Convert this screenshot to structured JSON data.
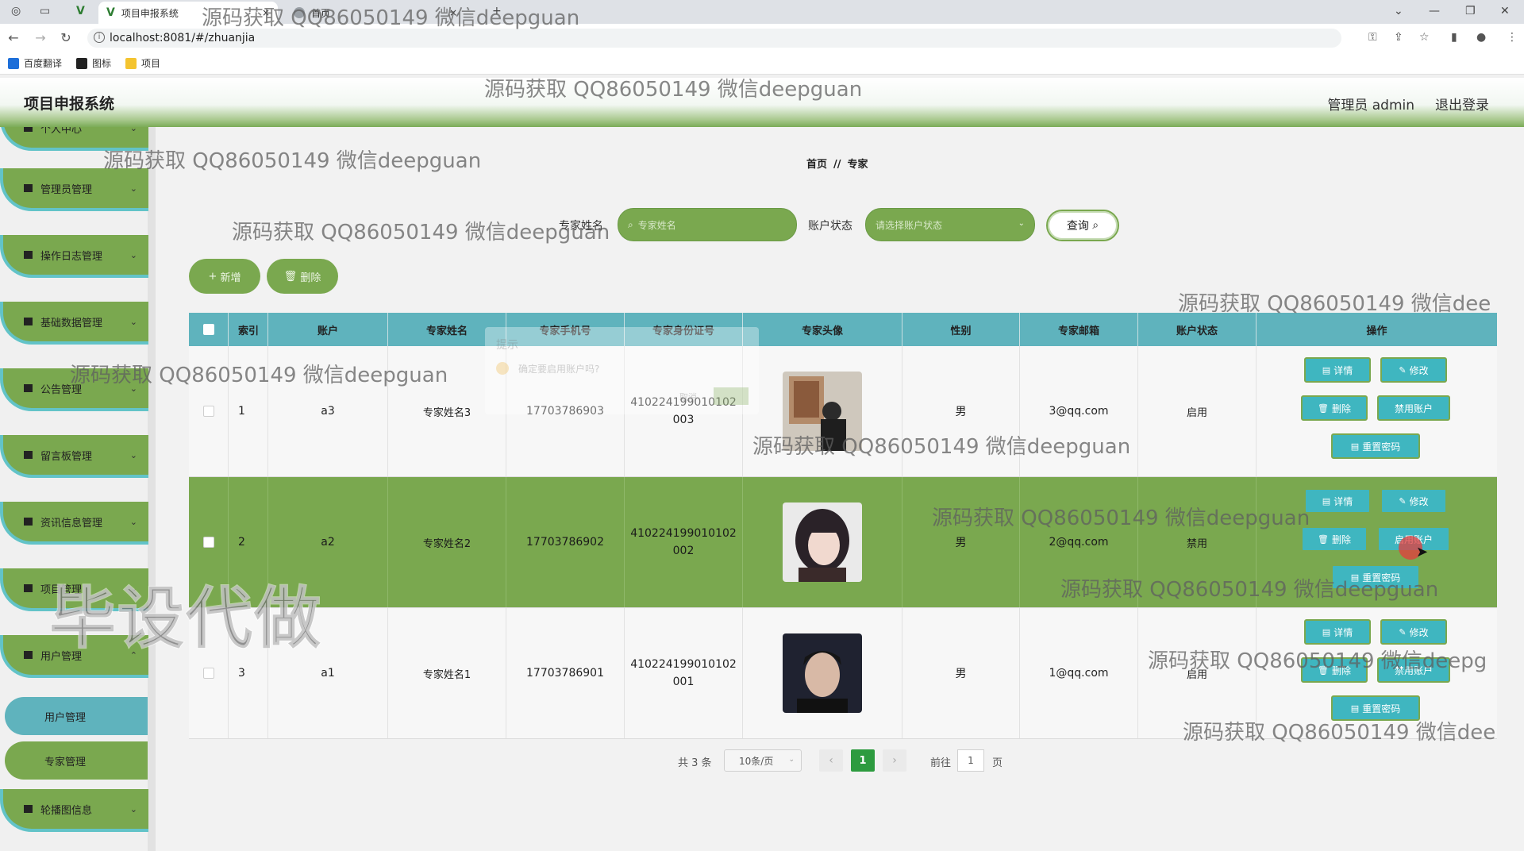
{
  "browser": {
    "tabs": [
      {
        "title": "项目申报系统"
      },
      {
        "title": "首页"
      }
    ],
    "url": "localhost:8081/#/zhuanjia",
    "bookmarks": [
      "百度翻译",
      "图标",
      "项目"
    ]
  },
  "header": {
    "title": "项目申报系统",
    "user": "管理员 admin",
    "logout": "退出登录"
  },
  "sidebar": {
    "items": [
      {
        "label": "个人中心",
        "icon": "user-icon"
      },
      {
        "label": "管理员管理",
        "icon": "monitor-icon"
      },
      {
        "label": "操作日志管理",
        "icon": "doc-icon"
      },
      {
        "label": "基础数据管理",
        "icon": "grid-icon"
      },
      {
        "label": "公告管理",
        "icon": "grid-icon"
      },
      {
        "label": "留言板管理",
        "icon": "grid-icon"
      },
      {
        "label": "资讯信息管理",
        "icon": "grid-icon"
      },
      {
        "label": "项目管理",
        "icon": "user-icon"
      },
      {
        "label": "用户管理",
        "icon": "monitor-icon"
      },
      {
        "label": "轮播图信息",
        "icon": "monitor-icon"
      }
    ],
    "subitems": [
      "用户管理",
      "专家管理"
    ]
  },
  "breadcrumb": {
    "home": "首页",
    "sep": "//",
    "current": "专家"
  },
  "search": {
    "name_label": "专家姓名",
    "name_placeholder": "专家姓名",
    "status_label": "账户状态",
    "status_placeholder": "请选择账户状态",
    "query_btn": "查询"
  },
  "actions": {
    "add": "新增",
    "delete": "删除"
  },
  "table": {
    "columns": [
      "索引",
      "账户",
      "专家姓名",
      "专家手机号",
      "专家身份证号",
      "专家头像",
      "性别",
      "专家邮箱",
      "账户状态",
      "操作"
    ],
    "rows": [
      {
        "index": "1",
        "account": "a3",
        "name": "专家姓名3",
        "phone": "17703786903",
        "id1": "410224199010102",
        "id2": "003",
        "gender": "男",
        "email": "3@qq.com",
        "status": "启用",
        "toggle": "禁用账户",
        "avatar": "avatar-1"
      },
      {
        "index": "2",
        "account": "a2",
        "name": "专家姓名2",
        "phone": "17703786902",
        "id1": "410224199010102",
        "id2": "002",
        "gender": "男",
        "email": "2@qq.com",
        "status": "禁用",
        "toggle": "启用账户",
        "avatar": "avatar-2"
      },
      {
        "index": "3",
        "account": "a1",
        "name": "专家姓名1",
        "phone": "17703786901",
        "id1": "410224199010102",
        "id2": "001",
        "gender": "男",
        "email": "1@qq.com",
        "status": "启用",
        "toggle": "禁用账户",
        "avatar": "avatar-3"
      }
    ],
    "ops": {
      "detail": "详情",
      "edit": "修改",
      "delete": "删除",
      "reset": "重置密码"
    }
  },
  "popconfirm": {
    "title": "提示",
    "message": "确定要启用账户吗?",
    "cancel": "取消",
    "ok": "确定"
  },
  "pager": {
    "total": "共 3 条",
    "size": "10条/页",
    "current": "1",
    "goto_label": "前往",
    "goto_value": "1",
    "page_unit": "页"
  },
  "watermark": {
    "text": "源码获取 QQ86050149 微信deepguan",
    "text_cut1": "源码获取 QQ86050149 微信dee",
    "text_cut2": "源码获取 QQ86050149 微信deepg",
    "big": "毕设代做"
  },
  "colors": {
    "green": "#7aa84f",
    "teal": "#5fb3bd",
    "opbtn": "#3fb6c0",
    "pager": "#2d9b3f"
  }
}
